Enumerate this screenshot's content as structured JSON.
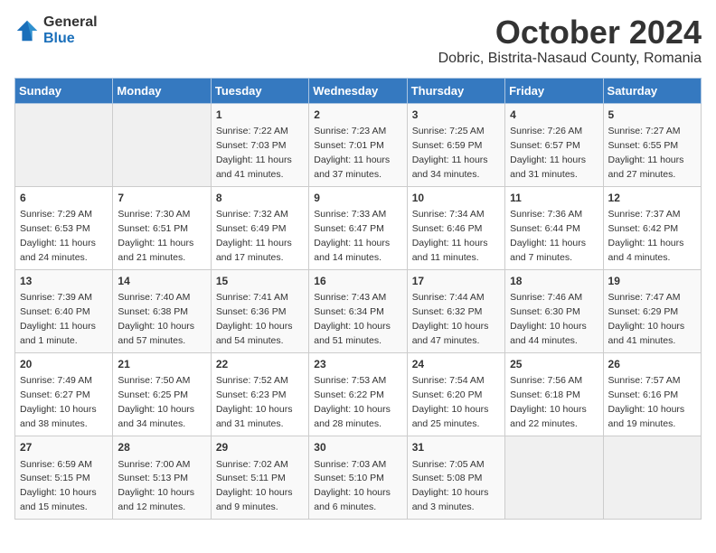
{
  "logo": {
    "general": "General",
    "blue": "Blue"
  },
  "title": "October 2024",
  "location": "Dobric, Bistrita-Nasaud County, Romania",
  "days_of_week": [
    "Sunday",
    "Monday",
    "Tuesday",
    "Wednesday",
    "Thursday",
    "Friday",
    "Saturday"
  ],
  "weeks": [
    [
      {
        "day": "",
        "empty": true
      },
      {
        "day": "",
        "empty": true
      },
      {
        "day": "1",
        "sunrise": "7:22 AM",
        "sunset": "7:03 PM",
        "daylight": "11 hours and 41 minutes."
      },
      {
        "day": "2",
        "sunrise": "7:23 AM",
        "sunset": "7:01 PM",
        "daylight": "11 hours and 37 minutes."
      },
      {
        "day": "3",
        "sunrise": "7:25 AM",
        "sunset": "6:59 PM",
        "daylight": "11 hours and 34 minutes."
      },
      {
        "day": "4",
        "sunrise": "7:26 AM",
        "sunset": "6:57 PM",
        "daylight": "11 hours and 31 minutes."
      },
      {
        "day": "5",
        "sunrise": "7:27 AM",
        "sunset": "6:55 PM",
        "daylight": "11 hours and 27 minutes."
      }
    ],
    [
      {
        "day": "6",
        "sunrise": "7:29 AM",
        "sunset": "6:53 PM",
        "daylight": "11 hours and 24 minutes."
      },
      {
        "day": "7",
        "sunrise": "7:30 AM",
        "sunset": "6:51 PM",
        "daylight": "11 hours and 21 minutes."
      },
      {
        "day": "8",
        "sunrise": "7:32 AM",
        "sunset": "6:49 PM",
        "daylight": "11 hours and 17 minutes."
      },
      {
        "day": "9",
        "sunrise": "7:33 AM",
        "sunset": "6:47 PM",
        "daylight": "11 hours and 14 minutes."
      },
      {
        "day": "10",
        "sunrise": "7:34 AM",
        "sunset": "6:46 PM",
        "daylight": "11 hours and 11 minutes."
      },
      {
        "day": "11",
        "sunrise": "7:36 AM",
        "sunset": "6:44 PM",
        "daylight": "11 hours and 7 minutes."
      },
      {
        "day": "12",
        "sunrise": "7:37 AM",
        "sunset": "6:42 PM",
        "daylight": "11 hours and 4 minutes."
      }
    ],
    [
      {
        "day": "13",
        "sunrise": "7:39 AM",
        "sunset": "6:40 PM",
        "daylight": "11 hours and 1 minute."
      },
      {
        "day": "14",
        "sunrise": "7:40 AM",
        "sunset": "6:38 PM",
        "daylight": "10 hours and 57 minutes."
      },
      {
        "day": "15",
        "sunrise": "7:41 AM",
        "sunset": "6:36 PM",
        "daylight": "10 hours and 54 minutes."
      },
      {
        "day": "16",
        "sunrise": "7:43 AM",
        "sunset": "6:34 PM",
        "daylight": "10 hours and 51 minutes."
      },
      {
        "day": "17",
        "sunrise": "7:44 AM",
        "sunset": "6:32 PM",
        "daylight": "10 hours and 47 minutes."
      },
      {
        "day": "18",
        "sunrise": "7:46 AM",
        "sunset": "6:30 PM",
        "daylight": "10 hours and 44 minutes."
      },
      {
        "day": "19",
        "sunrise": "7:47 AM",
        "sunset": "6:29 PM",
        "daylight": "10 hours and 41 minutes."
      }
    ],
    [
      {
        "day": "20",
        "sunrise": "7:49 AM",
        "sunset": "6:27 PM",
        "daylight": "10 hours and 38 minutes."
      },
      {
        "day": "21",
        "sunrise": "7:50 AM",
        "sunset": "6:25 PM",
        "daylight": "10 hours and 34 minutes."
      },
      {
        "day": "22",
        "sunrise": "7:52 AM",
        "sunset": "6:23 PM",
        "daylight": "10 hours and 31 minutes."
      },
      {
        "day": "23",
        "sunrise": "7:53 AM",
        "sunset": "6:22 PM",
        "daylight": "10 hours and 28 minutes."
      },
      {
        "day": "24",
        "sunrise": "7:54 AM",
        "sunset": "6:20 PM",
        "daylight": "10 hours and 25 minutes."
      },
      {
        "day": "25",
        "sunrise": "7:56 AM",
        "sunset": "6:18 PM",
        "daylight": "10 hours and 22 minutes."
      },
      {
        "day": "26",
        "sunrise": "7:57 AM",
        "sunset": "6:16 PM",
        "daylight": "10 hours and 19 minutes."
      }
    ],
    [
      {
        "day": "27",
        "sunrise": "6:59 AM",
        "sunset": "5:15 PM",
        "daylight": "10 hours and 15 minutes."
      },
      {
        "day": "28",
        "sunrise": "7:00 AM",
        "sunset": "5:13 PM",
        "daylight": "10 hours and 12 minutes."
      },
      {
        "day": "29",
        "sunrise": "7:02 AM",
        "sunset": "5:11 PM",
        "daylight": "10 hours and 9 minutes."
      },
      {
        "day": "30",
        "sunrise": "7:03 AM",
        "sunset": "5:10 PM",
        "daylight": "10 hours and 6 minutes."
      },
      {
        "day": "31",
        "sunrise": "7:05 AM",
        "sunset": "5:08 PM",
        "daylight": "10 hours and 3 minutes."
      },
      {
        "day": "",
        "empty": true
      },
      {
        "day": "",
        "empty": true
      }
    ]
  ]
}
